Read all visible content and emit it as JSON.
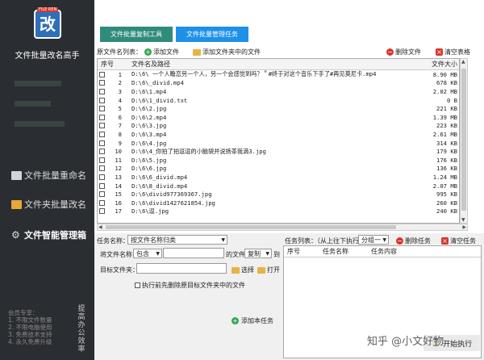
{
  "app": {
    "logo_tag": "FILE REN",
    "logo_char": "改",
    "title": "文件批量改名高手"
  },
  "nav": [
    {
      "label": "文件批量重命名"
    },
    {
      "label": "文件夹批量改名"
    },
    {
      "label": "文件智能管理箱"
    }
  ],
  "promo": [
    "会员专享：",
    "1. 不限文件数量",
    "2. 不限电脑使用",
    "3. 免费技术支持",
    "4. 永久免费升级"
  ],
  "promo_vertical": "提高办公效率",
  "tabs": {
    "copy_tool": "文件批量复制工具",
    "manage_task": "文件批量管理任务"
  },
  "toolbar": {
    "list_label": "原文件名列表：",
    "add_file": "添加文件",
    "add_folder": "添加文件夹中的文件",
    "delete_file": "删除文件",
    "clear_table": "清空表格"
  },
  "grid": {
    "headers": {
      "no": "序号",
      "path": "文件名及路径",
      "size": "文件大小"
    },
    "rows": [
      {
        "no": "1",
        "path": "D:\\6\\ 一个人瞻恋另一个人，另一个会感觉到吗？＂#终于对这个音乐下手了#再见莫尼卡.mp4",
        "size": "8.90 MB"
      },
      {
        "no": "2",
        "path": "D:\\6\\_divid.mp4",
        "size": "678 KB"
      },
      {
        "no": "3",
        "path": "D:\\6\\1.mp4",
        "size": "2.02 MB"
      },
      {
        "no": "4",
        "path": "D:\\6\\1_divid.txt",
        "size": "0 B"
      },
      {
        "no": "5",
        "path": "D:\\6\\2.jpg",
        "size": "221 KB"
      },
      {
        "no": "6",
        "path": "D:\\6\\2.mp4",
        "size": "1.39 MB"
      },
      {
        "no": "7",
        "path": "D:\\6\\3.jpg",
        "size": "223 KB"
      },
      {
        "no": "8",
        "path": "D:\\6\\3.mp4",
        "size": "2.61 MB"
      },
      {
        "no": "9",
        "path": "D:\\6\\4.jpg",
        "size": "314 KB"
      },
      {
        "no": "10",
        "path": "D:\\6\\4_你拍了拍逗逗的小脑袋并说扬茶我滴3.jpg",
        "size": "179 KB"
      },
      {
        "no": "11",
        "path": "D:\\6\\5.jpg",
        "size": "176 KB"
      },
      {
        "no": "12",
        "path": "D:\\6\\6.jpg",
        "size": "136 KB"
      },
      {
        "no": "13",
        "path": "D:\\6\\6_divid.mp4",
        "size": "1.24 MB"
      },
      {
        "no": "14",
        "path": "D:\\6\\8_divid.mp4",
        "size": "2.07 MB"
      },
      {
        "no": "15",
        "path": "D:\\6\\divid977369367.jpg",
        "size": "995 KB"
      },
      {
        "no": "16",
        "path": "D:\\6\\divid1427621854.jpg",
        "size": "260 KB"
      },
      {
        "no": "17",
        "path": "D:\\6\\逗.jpg",
        "size": "240 KB"
      }
    ]
  },
  "task": {
    "name_label": "任务名称：",
    "name_value": "按文件名称归类",
    "rule_prefix": "将文件名称",
    "rule_match": "包含",
    "rule_mid": "的文件",
    "rule_action": "复制",
    "rule_suffix": "到",
    "target_label": "目标文件夹：",
    "choose": "选择",
    "open": "打开",
    "delete_before": "执行前先删除原目标文件夹中的文件",
    "add_task": "添加本任务"
  },
  "tasklist": {
    "label": "任务列表：（从上往下执行）",
    "group": "分组一",
    "delete_task": "删除任务",
    "clear_task": "清空任务",
    "headers": {
      "no": "序号",
      "name": "任务名称",
      "content": "任务内容"
    }
  },
  "watermark": "知乎 @小文好物",
  "execute": "开始执行"
}
